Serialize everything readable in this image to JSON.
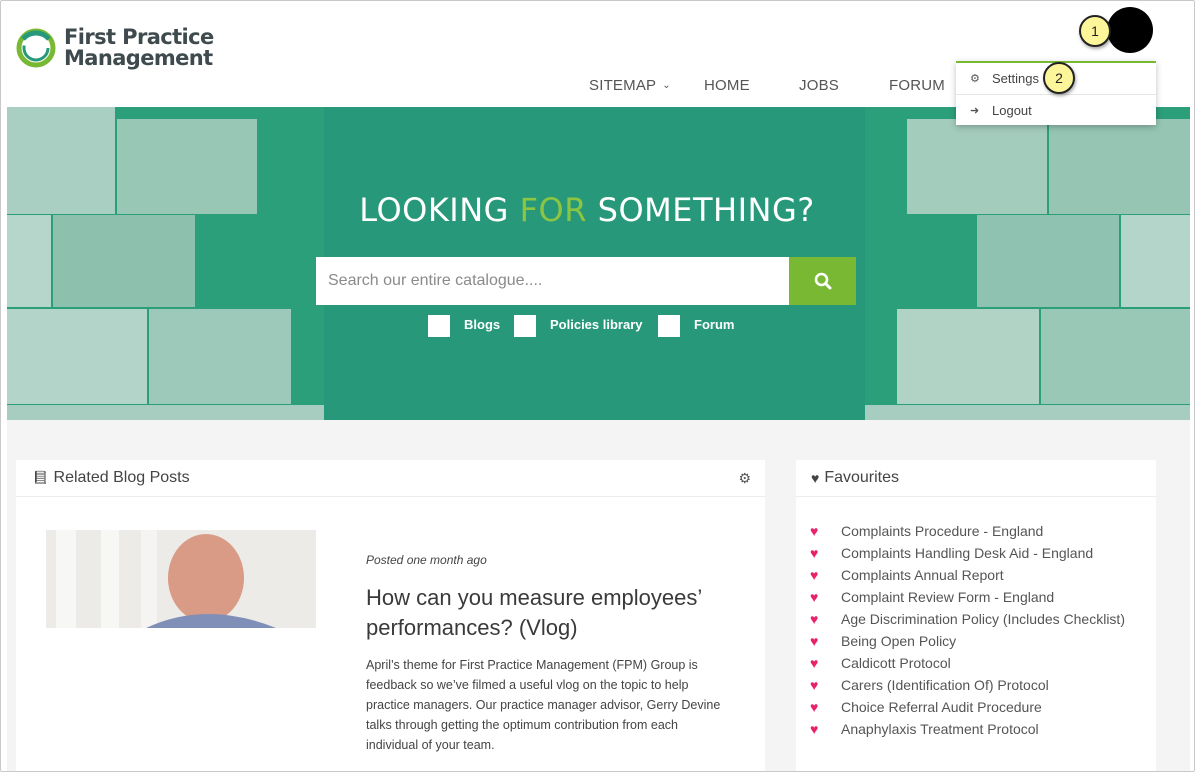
{
  "logo": {
    "line1": "First Practice",
    "line2": "Management"
  },
  "nav": {
    "sitemap": "SITEMAP",
    "home": "HOME",
    "jobs": "JOBS",
    "forum": "FORUM"
  },
  "user_menu": {
    "settings": "Settings",
    "logout": "Logout",
    "settings_icon": "gears-icon",
    "logout_icon": "sign-out-icon"
  },
  "callouts": {
    "first": "1",
    "second": "2"
  },
  "hero": {
    "title_before": "LOOKING ",
    "title_accent": "FOR",
    "title_after": " SOMETHING?",
    "search_placeholder": "Search our entire catalogue....",
    "search_value": "",
    "filters": [
      "Blogs",
      "Policies library",
      "Forum"
    ]
  },
  "blog_panel": {
    "title": "Related Blog Posts",
    "posted": "Posted one month ago",
    "post_title": "How can you measure employees’ performances? (Vlog)",
    "post_body": "April’s theme for First Practice Management (FPM) Group is feedback so we’ve filmed a useful vlog on the topic to help practice managers. Our practice manager advisor, Gerry Devine talks through getting the optimum contribution from each individual of your team."
  },
  "favourites_panel": {
    "title": "Favourites",
    "items": [
      "Complaints Procedure - England",
      "Complaints Handling Desk Aid - England",
      "Complaints Annual Report",
      "Complaint Review Form - England",
      "Age Discrimination Policy (Includes Checklist)",
      "Being Open Policy",
      "Caldicott Protocol",
      "Carers (Identification Of) Protocol",
      "Choice Referral Audit Procedure",
      "Anaphylaxis Treatment Protocol"
    ]
  },
  "colors": {
    "brand_green": "#27997a",
    "accent_green": "#79b833",
    "heart_pink": "#e8216b"
  }
}
